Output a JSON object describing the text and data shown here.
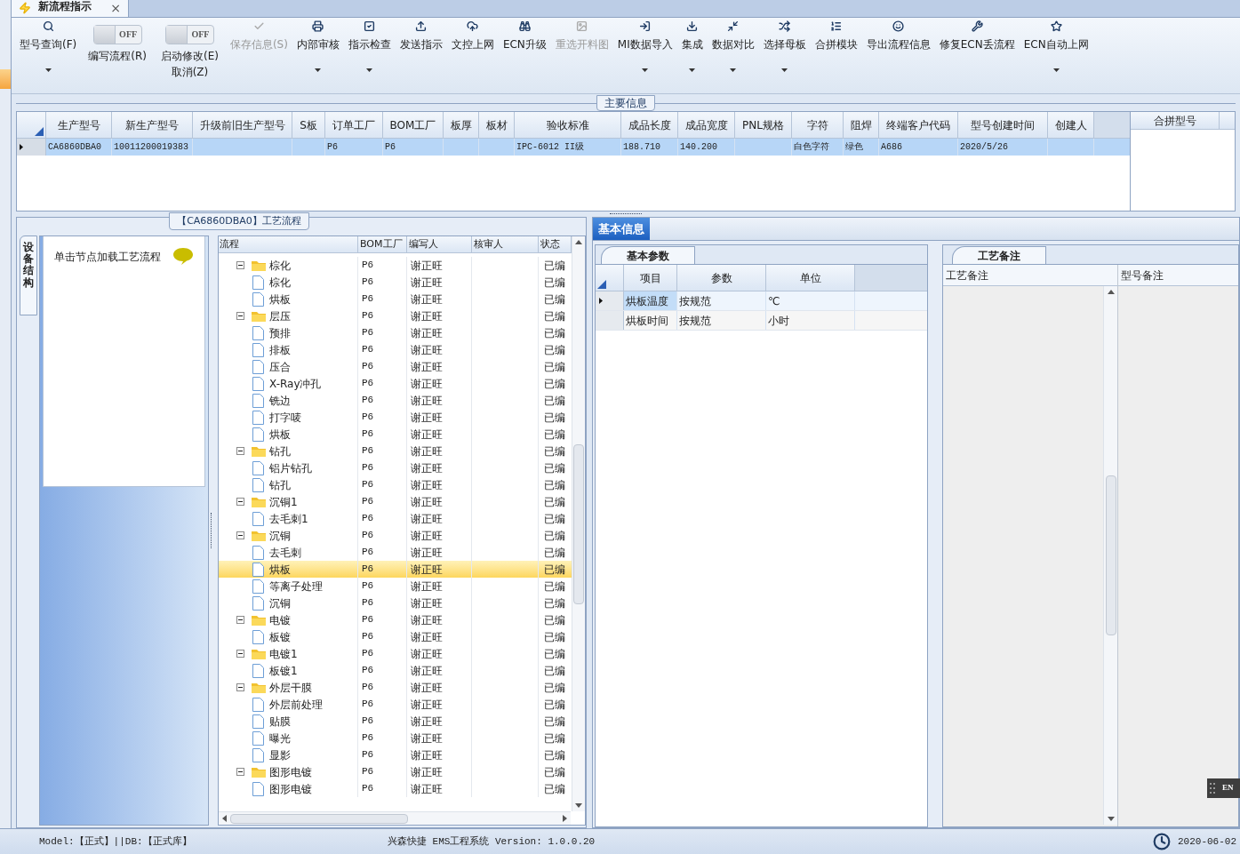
{
  "doc_tab": {
    "title": "新流程指示",
    "close": "×",
    "selected": true
  },
  "toolbar": [
    {
      "kind": "button",
      "label": "型号查询(F)",
      "disabled": false,
      "menu": true
    },
    {
      "kind": "toggle",
      "label": "编写流程(R)",
      "state_text": "OFF",
      "on": false
    },
    {
      "kind": "toggle",
      "label": "启动修改(E)",
      "sublabel": "取消(Z)",
      "state_text": "OFF",
      "on": false
    },
    {
      "kind": "button",
      "label": "保存信息(S)",
      "disabled": true,
      "menu": false
    },
    {
      "kind": "button",
      "label": "内部审核",
      "disabled": false,
      "menu": true
    },
    {
      "kind": "button",
      "label": "指示检查",
      "disabled": false,
      "menu": true
    },
    {
      "kind": "button",
      "label": "发送指示",
      "disabled": false,
      "menu": false
    },
    {
      "kind": "button",
      "label": "文控上网",
      "disabled": false,
      "menu": false
    },
    {
      "kind": "button",
      "label": "ECN升级",
      "disabled": false,
      "menu": false
    },
    {
      "kind": "button",
      "label": "重选开料图",
      "disabled": true,
      "menu": false
    },
    {
      "kind": "button",
      "label": "MI数据导入",
      "disabled": false,
      "menu": true
    },
    {
      "kind": "button",
      "label": "集成",
      "disabled": false,
      "menu": true
    },
    {
      "kind": "button",
      "label": "数据对比",
      "disabled": false,
      "menu": true
    },
    {
      "kind": "button",
      "label": "选择母板",
      "disabled": false,
      "menu": true
    },
    {
      "kind": "button",
      "label": "合拼模块",
      "disabled": false,
      "menu": false
    },
    {
      "kind": "button",
      "label": "导出流程信息",
      "disabled": false,
      "menu": false
    },
    {
      "kind": "button",
      "label": "修复ECN丢流程",
      "disabled": false,
      "menu": false
    },
    {
      "kind": "button",
      "label": "ECN自动上网",
      "disabled": false,
      "menu": true
    }
  ],
  "main_info": {
    "title": "主要信息",
    "columns": [
      "生产型号",
      "新生产型号",
      "升级前旧生产型号",
      "S板",
      "订单工厂",
      "BOM工厂",
      "板厚",
      "板材",
      "验收标准",
      "成品长度",
      "成品宽度",
      "PNL规格",
      "字符",
      "阻焊",
      "终端客户代码",
      "型号创建时间",
      "创建人"
    ],
    "rows": [
      {
        "selected": true,
        "cells": [
          "CA6860DBA0",
          "10011200019383",
          "",
          "",
          "P6",
          "P6",
          "",
          "",
          "IPC-6012 II级",
          "188.710",
          "140.200",
          "",
          "白色字符",
          "绿色",
          "A686",
          "2020/5/26",
          ""
        ]
      }
    ],
    "merge_panel": {
      "columns": [
        "合拼型号"
      ]
    }
  },
  "process_panel": {
    "title": "【CA6860DBA0】工艺流程",
    "side_tab": {
      "label": "设备结构",
      "selected": true
    },
    "hint": "单击节点加载工艺流程",
    "columns": [
      "流程",
      "BOM工厂",
      "编写人",
      "核审人",
      "状态"
    ],
    "nodes": [
      {
        "name": "棕化",
        "bom": "P6",
        "writer": "谢正旺",
        "status": "已编",
        "expanded": true,
        "selected": false,
        "children": [
          {
            "name": "棕化",
            "bom": "P6",
            "writer": "谢正旺",
            "status": "已编",
            "selected": false
          },
          {
            "name": "烘板",
            "bom": "P6",
            "writer": "谢正旺",
            "status": "已编",
            "selected": false
          }
        ]
      },
      {
        "name": "层压",
        "bom": "P6",
        "writer": "谢正旺",
        "status": "已编",
        "expanded": true,
        "selected": false,
        "children": [
          {
            "name": "预排",
            "bom": "P6",
            "writer": "谢正旺",
            "status": "已编",
            "selected": false
          },
          {
            "name": "排板",
            "bom": "P6",
            "writer": "谢正旺",
            "status": "已编",
            "selected": false
          },
          {
            "name": "压合",
            "bom": "P6",
            "writer": "谢正旺",
            "status": "已编",
            "selected": false
          },
          {
            "name": "X-Ray冲孔",
            "bom": "P6",
            "writer": "谢正旺",
            "status": "已编",
            "selected": false
          },
          {
            "name": "铣边",
            "bom": "P6",
            "writer": "谢正旺",
            "status": "已编",
            "selected": false
          },
          {
            "name": "打字唛",
            "bom": "P6",
            "writer": "谢正旺",
            "status": "已编",
            "selected": false
          },
          {
            "name": "烘板",
            "bom": "P6",
            "writer": "谢正旺",
            "status": "已编",
            "selected": false
          }
        ]
      },
      {
        "name": "钻孔",
        "bom": "P6",
        "writer": "谢正旺",
        "status": "已编",
        "expanded": true,
        "selected": false,
        "children": [
          {
            "name": "铝片钻孔",
            "bom": "P6",
            "writer": "谢正旺",
            "status": "已编",
            "selected": false
          },
          {
            "name": "钻孔",
            "bom": "P6",
            "writer": "谢正旺",
            "status": "已编",
            "selected": false
          }
        ]
      },
      {
        "name": "沉铜1",
        "bom": "P6",
        "writer": "谢正旺",
        "status": "已编",
        "expanded": true,
        "selected": false,
        "children": [
          {
            "name": "去毛刺1",
            "bom": "P6",
            "writer": "谢正旺",
            "status": "已编",
            "selected": false
          }
        ]
      },
      {
        "name": "沉铜",
        "bom": "P6",
        "writer": "谢正旺",
        "status": "已编",
        "expanded": true,
        "selected": false,
        "children": [
          {
            "name": "去毛刺",
            "bom": "P6",
            "writer": "谢正旺",
            "status": "已编",
            "selected": false
          },
          {
            "name": "烘板",
            "bom": "P6",
            "writer": "谢正旺",
            "status": "已编",
            "selected": true
          },
          {
            "name": "等离子处理",
            "bom": "P6",
            "writer": "谢正旺",
            "status": "已编",
            "selected": false
          },
          {
            "name": "沉铜",
            "bom": "P6",
            "writer": "谢正旺",
            "status": "已编",
            "selected": false
          }
        ]
      },
      {
        "name": "电镀",
        "bom": "P6",
        "writer": "谢正旺",
        "status": "已编",
        "expanded": true,
        "selected": false,
        "children": [
          {
            "name": "板镀",
            "bom": "P6",
            "writer": "谢正旺",
            "status": "已编",
            "selected": false
          }
        ]
      },
      {
        "name": "电镀1",
        "bom": "P6",
        "writer": "谢正旺",
        "status": "已编",
        "expanded": true,
        "selected": false,
        "children": [
          {
            "name": "板镀1",
            "bom": "P6",
            "writer": "谢正旺",
            "status": "已编",
            "selected": false
          }
        ]
      },
      {
        "name": "外层干膜",
        "bom": "P6",
        "writer": "谢正旺",
        "status": "已编",
        "expanded": true,
        "selected": false,
        "children": [
          {
            "name": "外层前处理",
            "bom": "P6",
            "writer": "谢正旺",
            "status": "已编",
            "selected": false
          },
          {
            "name": "贴膜",
            "bom": "P6",
            "writer": "谢正旺",
            "status": "已编",
            "selected": false
          },
          {
            "name": "曝光",
            "bom": "P6",
            "writer": "谢正旺",
            "status": "已编",
            "selected": false
          },
          {
            "name": "显影",
            "bom": "P6",
            "writer": "谢正旺",
            "status": "已编",
            "selected": false
          }
        ]
      },
      {
        "name": "图形电镀",
        "bom": "P6",
        "writer": "谢正旺",
        "status": "已编",
        "expanded": true,
        "selected": false,
        "children": [
          {
            "name": "图形电镀",
            "bom": "P6",
            "writer": "谢正旺",
            "status": "已编",
            "selected": false
          }
        ]
      }
    ]
  },
  "info_panel": {
    "tab": {
      "label": "基本信息",
      "selected": true
    },
    "params": {
      "tab": "基本参数",
      "columns": [
        "项目",
        "参数",
        "单位"
      ],
      "rows": [
        {
          "item": "烘板温度",
          "param": "按规范",
          "unit": "℃",
          "selected": true
        },
        {
          "item": "烘板时间",
          "param": "按规范",
          "unit": "小时",
          "selected": false
        }
      ]
    },
    "notes": {
      "tab": "工艺备注",
      "columns": [
        "工艺备注",
        "型号备注"
      ]
    }
  },
  "ime_badge": "EN",
  "status_bar": {
    "model": "Model:【正式】||DB:【正式库】",
    "app": "兴森快捷 EMS工程系统 Version: 1.0.0.20",
    "date": "2020-06-02"
  }
}
